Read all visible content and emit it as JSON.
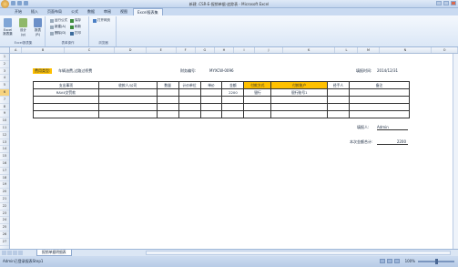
{
  "window": {
    "title": "新建 .CSR-E-报销单据-追踪表 - Microsoft Excel"
  },
  "tabs": [
    "开始",
    "插入",
    "页面布局",
    "公式",
    "数据",
    "审阅",
    "视图",
    "Excel报表集"
  ],
  "active_tab": "Excel报表集",
  "ribbon": {
    "group1": {
      "label": "Excel报表集",
      "btn1": "Excel报表集",
      "btn2": "设计(g)",
      "btn3": "报表(R)"
    },
    "group2": {
      "label": "表单操作",
      "s1": "运行公式",
      "s2": "新建(A)",
      "s3": "删除(D)",
      "s4": "保存",
      "s5": "刷新",
      "s6": "打印"
    },
    "group3": {
      "label": "浏览器",
      "s1": "打开网页"
    }
  },
  "columns": [
    "A",
    "B",
    "C",
    "D",
    "E",
    "F",
    "G",
    "H",
    "I",
    "J",
    "K",
    "L",
    "M",
    "N",
    "O"
  ],
  "rows": [
    "1",
    "2",
    "3",
    "4",
    "5",
    "6",
    "7",
    "8",
    "9",
    "10",
    "11",
    "12",
    "13",
    "14",
    "15",
    "16",
    "17",
    "18",
    "19",
    "20",
    "21",
    "22",
    "23",
    "24",
    "25",
    "26",
    "27"
  ],
  "form": {
    "expense_type_label": "费用类型:",
    "expense_type_value": "车辆油费,过路过桥费",
    "doc_no_label": "财务编号:",
    "doc_no_value": "MYXCW-0096",
    "fill_date_label": "填报时间:",
    "fill_date_value": "2014/12/31",
    "filler_label": "填报人:",
    "filler_value": "Admin",
    "total_label": "本次金额合计:",
    "total_value": "2200"
  },
  "table": {
    "headers": [
      "支出事项",
      "收款人/公司",
      "数量",
      "计价单位",
      "单价",
      "金额",
      "付款方式",
      "付款账户",
      "经手人",
      "备注"
    ],
    "rows": [
      [
        "RAV4交罚款",
        "",
        "",
        "",
        "",
        "2200",
        "银行",
        "银行账号1",
        "",
        ""
      ],
      [
        "",
        "",
        "",
        "",
        "",
        "",
        "",
        "",
        "",
        ""
      ],
      [
        "",
        "",
        "",
        "",
        "",
        "",
        "",
        "",
        "",
        ""
      ],
      [
        "",
        "",
        "",
        "",
        "",
        "",
        "",
        "",
        "",
        ""
      ]
    ]
  },
  "sheet_tab": "报销单据明细表",
  "status": {
    "text": "Admin已登录报表Step1",
    "zoom": "100%"
  }
}
